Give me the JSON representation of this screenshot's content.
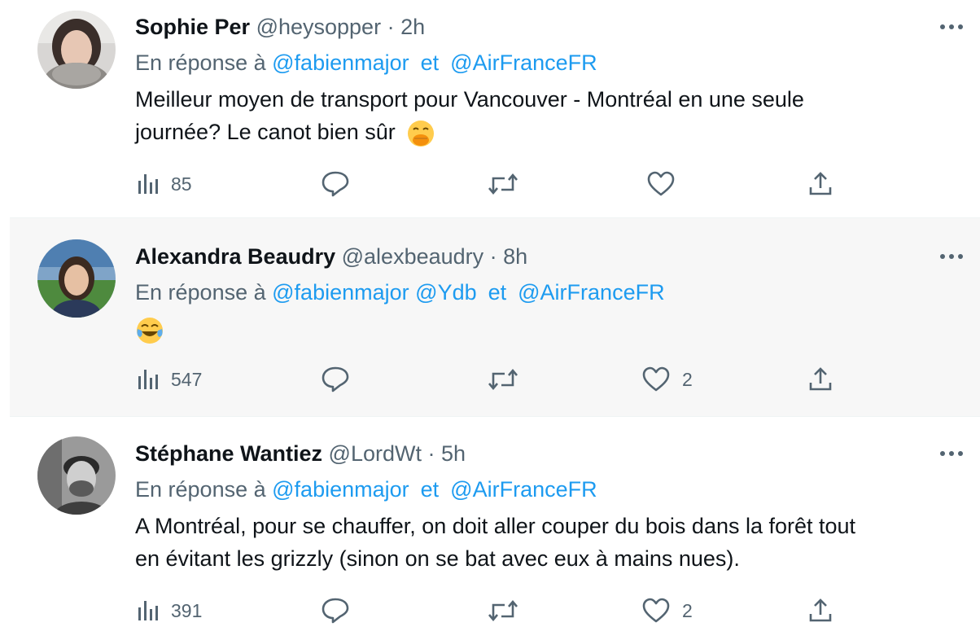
{
  "colors": {
    "accent": "#1d9bf0",
    "secondary": "#536471",
    "text": "#0f1419",
    "highlight_bg": "#f7f7f7"
  },
  "tweets": [
    {
      "name": "Sophie Per",
      "handle": "@heysopper",
      "time": "2h",
      "reply_prefix": "En réponse à",
      "mentions": [
        "@fabienmajor"
      ],
      "reply_sep": "et",
      "last_mention": "@AirFranceFR",
      "text_line1": "Meilleur moyen de transport pour Vancouver - Montréal en une seule",
      "text_line2": "journée? Le canot bien sûr",
      "emoji": "face-with-hand-over-mouth",
      "views": "85",
      "likes": ""
    },
    {
      "name": "Alexandra Beaudry",
      "handle": "@alexbeaudry",
      "time": "8h",
      "reply_prefix": "En réponse à",
      "mentions": [
        "@fabienmajor",
        "@Ydb"
      ],
      "reply_sep": "et",
      "last_mention": "@AirFranceFR",
      "emoji": "face-with-tears-of-joy",
      "views": "547",
      "likes": "2"
    },
    {
      "name": "Stéphane Wantiez",
      "handle": "@LordWt",
      "time": "5h",
      "reply_prefix": "En réponse à",
      "mentions": [
        "@fabienmajor"
      ],
      "reply_sep": "et",
      "last_mention": "@AirFranceFR",
      "text_line1": "A Montréal, pour se chauffer, on doit aller couper du bois dans la forêt tout",
      "text_line2": "en évitant les grizzly (sinon on se bat avec eux à mains nues).",
      "views": "391",
      "likes": "2"
    }
  ]
}
